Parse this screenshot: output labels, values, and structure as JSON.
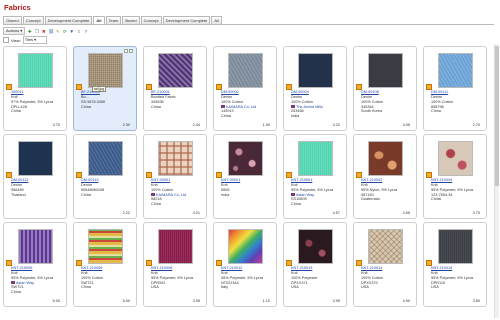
{
  "page": {
    "title": "Fabrics"
  },
  "tabs": [
    "Owned",
    "Concept",
    "Development Complete",
    "All",
    "Team",
    "Boxed",
    "Concept",
    "Development Complete",
    "All"
  ],
  "active_tab": 3,
  "toolbar": {
    "actions_label": "Actions",
    "view_label": "View:",
    "view_value": "Tiles",
    "icons": [
      "add-icon",
      "copy-icon",
      "delete-icon",
      "link-icon",
      "edit-icon",
      "refresh-icon",
      "filter-icon",
      "export-icon",
      "help-icon"
    ]
  },
  "tooltip": "tail.jpg",
  "items": [
    {
      "code": "100011",
      "type": "Knit",
      "content": "97% Polyester, 3% Lycra",
      "line3": "DPLL428",
      "origin": "China",
      "price": "3.75",
      "swatch": "mint"
    },
    {
      "code": "BF-210000",
      "type": "Bo...",
      "content": "",
      "line3": "SS.9876.3456",
      "origin": "China",
      "price": "2.30",
      "swatch": "burlap",
      "selected": true
    },
    {
      "code": "BF-210001",
      "type": "Bonded Fabric",
      "content": "",
      "line3": "345535",
      "origin": "China",
      "price": "2.44",
      "swatch": "purpleweave"
    },
    {
      "code": "DM-00002",
      "type": "Denim",
      "content": "100% Cotton",
      "vendor": "KAIMARA Co, Ltd",
      "line3": "145913",
      "origin": "China",
      "price": "1.50",
      "swatch": "graydenim"
    },
    {
      "code": "DM-00004",
      "type": "Denim",
      "content": "100% Cotton",
      "vendor": "The Arvind Mills",
      "line3": "253466",
      "origin": "India",
      "price": "3.20",
      "swatch": "navy"
    },
    {
      "code": "DM-00108",
      "type": "Denim",
      "content": "100% Cotton",
      "line3": "345344",
      "origin": "South Korea",
      "price": "4.05",
      "swatch": "charcoal"
    },
    {
      "code": "DM-00111",
      "type": "Denim",
      "content": "100% Cotton",
      "line3": "898798",
      "origin": "China",
      "price": "2.70",
      "swatch": "lightdenim"
    },
    {
      "code": "DM-00112",
      "type": "Denim",
      "content": "",
      "line3": "986489",
      "origin": "Thailand",
      "price": "0",
      "swatch": "darkdenim"
    },
    {
      "code": "DM-00113",
      "type": "Denim",
      "content": "",
      "line3": "65548984168",
      "origin": "China",
      "price": "2.22",
      "swatch": "bluedenim"
    },
    {
      "code": "KNT-00001",
      "type": "Knit",
      "content": "100% Cotton",
      "vendor": "KAIMARA Co, Ltd",
      "line3": "98218",
      "origin": "China",
      "price": "4.21",
      "swatch": "plaid"
    },
    {
      "code": "KNT-00001",
      "type": "Knit",
      "content": "",
      "line3": "5555",
      "origin": "India",
      "price": "0",
      "swatch": "floral"
    },
    {
      "code": "KNT-210001",
      "type": "Knit",
      "content": "95% Polyester, 5% Lycra",
      "vendor": "Asian Way",
      "line3": "SS10805",
      "origin": "China",
      "price": "4.57",
      "swatch": "mint"
    },
    {
      "code": "KNT-210002",
      "type": "Knit",
      "content": "95% Nylon, 5% Lycra",
      "line3": "987163",
      "origin": "Guatemala",
      "price": "4.65",
      "swatch": "paisley"
    },
    {
      "code": "KNT-210004",
      "type": "Knit",
      "content": "95% Polyester, 5% Lycra",
      "line3": "123-7654-34",
      "origin": "China",
      "price": "3.75",
      "swatch": "rosefloral"
    },
    {
      "code": "KNT-210005",
      "type": "Knit",
      "content": "95% Polyester, 5% Lycra",
      "vendor": "Asian Way",
      "line3": "SWT21",
      "origin": "China",
      "price": "5.00",
      "swatch": "purplecable"
    },
    {
      "code": "KNT-210006",
      "type": "Knit",
      "content": "100% Cotton",
      "line3": "SWT21",
      "origin": "China",
      "price": "5.00",
      "swatch": "stripe"
    },
    {
      "code": "KNT-210008",
      "type": "Knit",
      "content": "95% Polyester, 5% Lycra",
      "line3": "DPR002",
      "origin": "USA",
      "price": "3.95",
      "swatch": "magenta"
    },
    {
      "code": "KNT-210012",
      "type": "Knit",
      "content": "95% Polyester, 5% Lycra",
      "line3": "NT022344",
      "origin": "Italy",
      "price": "1.10",
      "swatch": "rainbow"
    },
    {
      "code": "KNT-210013",
      "type": "Knit",
      "content": "100% Polyester",
      "line3": "DPXX371",
      "origin": "USA",
      "price": "3.95",
      "swatch": "darkfloral"
    },
    {
      "code": "KNT-210014",
      "type": "Knit",
      "content": "100% Cotton",
      "line3": "DPXX370",
      "origin": "USA",
      "price": "4.90",
      "swatch": "beigepattern"
    },
    {
      "code": "KNT-210018",
      "type": "Knit",
      "content": "95% Polyester, 5% Lycra",
      "line3": "DPR115",
      "origin": "USA",
      "price": "3.80",
      "swatch": "slate"
    }
  ]
}
